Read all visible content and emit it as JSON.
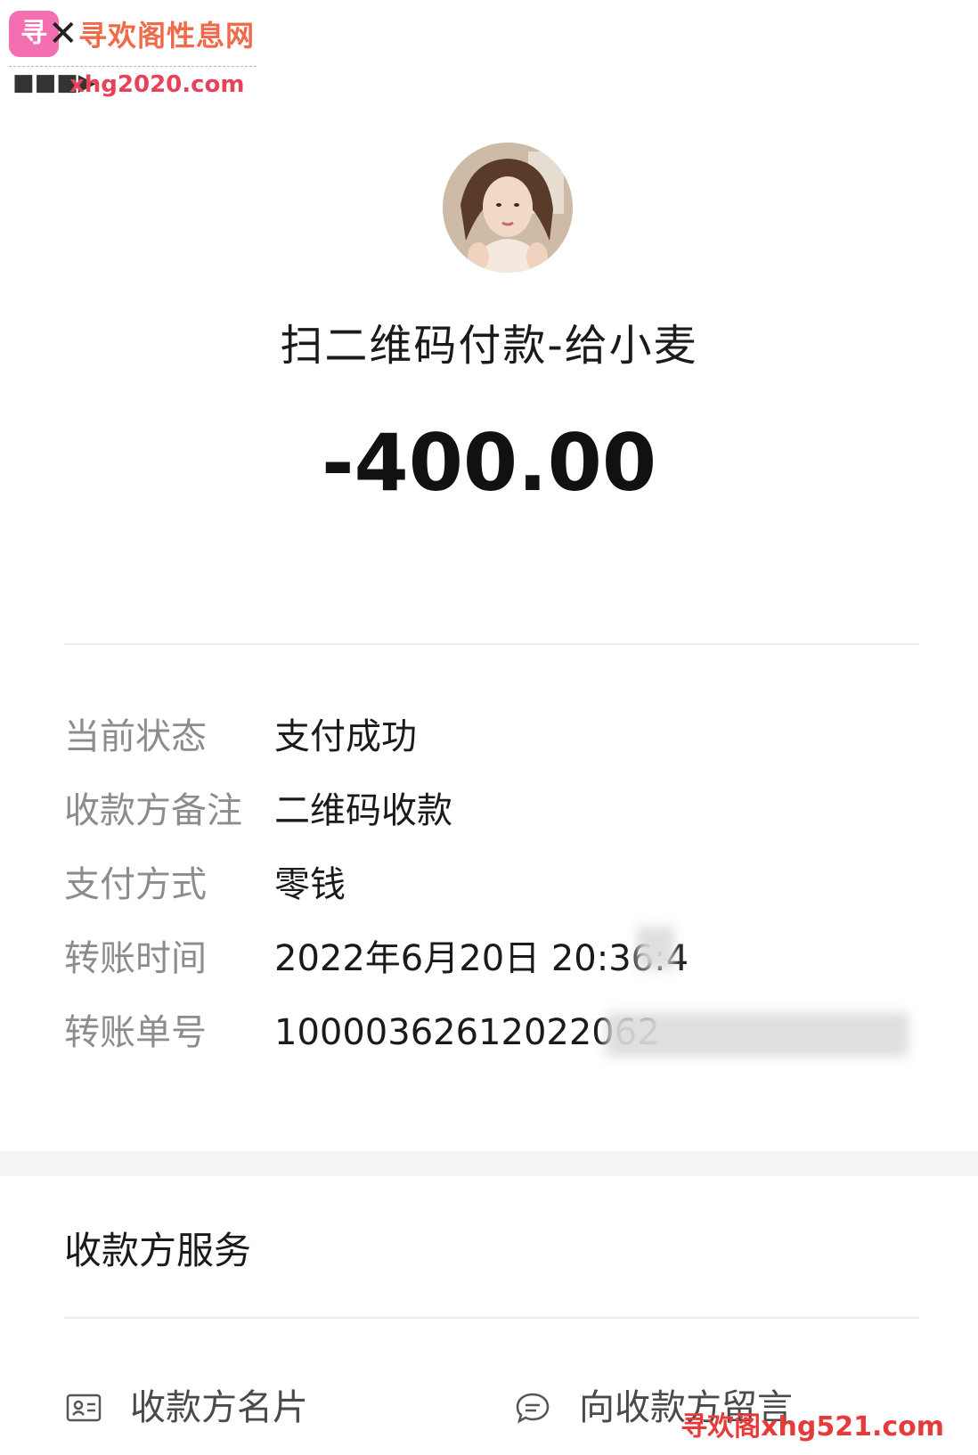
{
  "watermark": {
    "logo_text": "寻欢",
    "site_name": "寻欢阁性息网",
    "site_url": "xhg2020.com",
    "arrow": "■■■▶",
    "bottom_text": "寻欢阁xhg521.com"
  },
  "transaction": {
    "title": "扫二维码付款-给小麦",
    "amount": "-400.00"
  },
  "details": [
    {
      "label": "当前状态",
      "value": "支付成功"
    },
    {
      "label": "收款方备注",
      "value": "二维码收款"
    },
    {
      "label": "支付方式",
      "value": "零钱"
    },
    {
      "label": "转账时间",
      "value": "2022年6月20日 20:36:4"
    },
    {
      "label": "转账单号",
      "value": "10000362612022062"
    }
  ],
  "services": {
    "section_title": "收款方服务",
    "card_label": "收款方名片",
    "message_label": "向收款方留言",
    "card_icon": "contact-card-icon",
    "message_icon": "chat-bubble-icon"
  },
  "colors": {
    "label_gray": "#8c8c8c",
    "text_dark": "#1a1a1a",
    "divider": "#ececec"
  }
}
